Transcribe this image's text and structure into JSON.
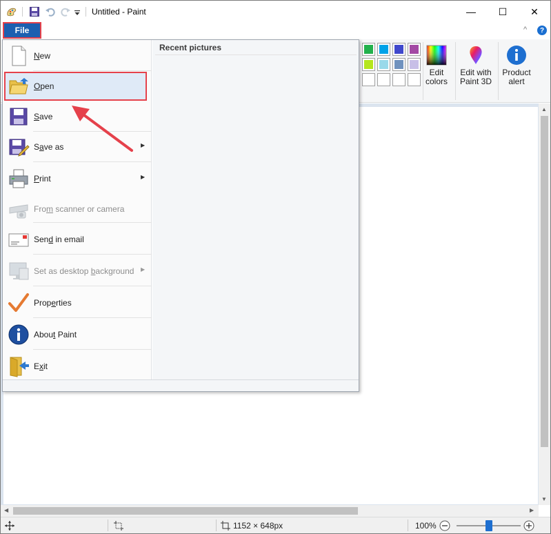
{
  "window": {
    "title": "Untitled - Paint",
    "minimize": "—",
    "maximize": "☐",
    "close": "✕"
  },
  "ribbon": {
    "file_tab": "File",
    "collapse_glyph": "^",
    "help_glyph": "?",
    "edit_colors": [
      "Edit",
      "colors"
    ],
    "edit_with_paint3d": [
      "Edit with",
      "Paint 3D"
    ],
    "product_alert": [
      "Product",
      "alert"
    ],
    "palette_row1": [
      "#22b14c",
      "#00a2e8",
      "#3f48cc",
      "#a349a4"
    ],
    "palette_row2": [
      "#b5e61d",
      "#99d9ea",
      "#7092be",
      "#c8bfe7"
    ]
  },
  "file_menu": {
    "recent_header": "Recent pictures",
    "items": [
      {
        "label": "New",
        "accel": "N",
        "icon": "new-document-icon",
        "enabled": true,
        "submenu": false
      },
      {
        "label": "Open",
        "accel": "O",
        "icon": "open-folder-icon",
        "enabled": true,
        "submenu": false
      },
      {
        "label": "Save",
        "accel": "S",
        "icon": "save-disk-icon",
        "enabled": true,
        "submenu": false
      },
      {
        "label": "Save as",
        "accel": "a",
        "icon": "save-as-icon",
        "enabled": true,
        "submenu": true
      },
      {
        "label": "Print",
        "accel": "P",
        "icon": "printer-icon",
        "enabled": true,
        "submenu": true
      },
      {
        "label": "From scanner or camera",
        "accel": "m",
        "icon": "scanner-icon",
        "enabled": false,
        "submenu": false
      },
      {
        "label": "Send in email",
        "accel": "d",
        "icon": "email-icon",
        "enabled": true,
        "submenu": false
      },
      {
        "label": "Set as desktop background",
        "accel": "b",
        "icon": "desktop-background-icon",
        "enabled": false,
        "submenu": true
      },
      {
        "label": "Properties",
        "accel": "e",
        "icon": "properties-checkmark-icon",
        "enabled": true,
        "submenu": false
      },
      {
        "label": "About Paint",
        "accel": "t",
        "icon": "about-info-icon",
        "enabled": true,
        "submenu": false
      },
      {
        "label": "Exit",
        "accel": "x",
        "icon": "exit-icon",
        "enabled": true,
        "submenu": false
      }
    ]
  },
  "statusbar": {
    "dimensions": "1152 × 648px",
    "zoom": "100%",
    "zoom_level": 1.0
  },
  "colors": {
    "file_tab": "#1c5fb0",
    "annotation_red": "#e5414b",
    "workspace": "#dbe4ef"
  }
}
